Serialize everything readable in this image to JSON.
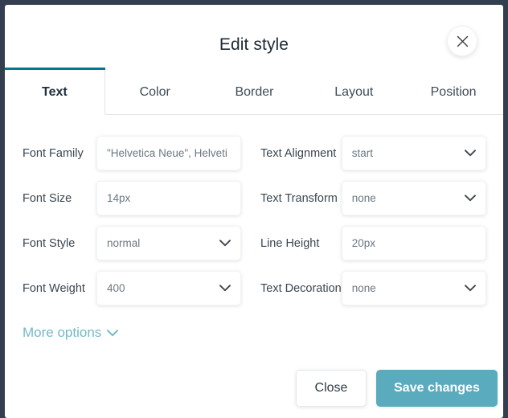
{
  "dialog": {
    "title": "Edit style",
    "close_icon": "close-x-icon"
  },
  "tabs": [
    {
      "label": "Text",
      "active": true
    },
    {
      "label": "Color",
      "active": false
    },
    {
      "label": "Border",
      "active": false
    },
    {
      "label": "Layout",
      "active": false
    },
    {
      "label": "Position",
      "active": false
    }
  ],
  "fields": {
    "font_family": {
      "label": "Font Family",
      "value": "\"Helvetica Neue\", Helveti",
      "type": "text"
    },
    "font_size": {
      "label": "Font Size",
      "value": "14px",
      "type": "text"
    },
    "font_style": {
      "label": "Font Style",
      "value": "normal",
      "type": "select"
    },
    "font_weight": {
      "label": "Font Weight",
      "value": "400",
      "type": "select"
    },
    "text_alignment": {
      "label": "Text Alignment",
      "value": "start",
      "type": "select"
    },
    "text_transform": {
      "label": "Text Transform",
      "value": "none",
      "type": "select"
    },
    "line_height": {
      "label": "Line Height",
      "value": "20px",
      "type": "text"
    },
    "text_decoration": {
      "label": "Text Decoration",
      "value": "none",
      "type": "select"
    }
  },
  "more_options": {
    "label": "More options",
    "icon": "chevron-down-icon"
  },
  "footer": {
    "close_label": "Close",
    "save_label": "Save changes"
  },
  "colors": {
    "backdrop": "#333f50",
    "modal_bg": "#ffffff",
    "active_tab_accent": "#00798c",
    "link_teal": "#73b9c8",
    "primary_button": "#5babbe",
    "label_text": "#3b4650",
    "value_text": "#6c7781"
  }
}
